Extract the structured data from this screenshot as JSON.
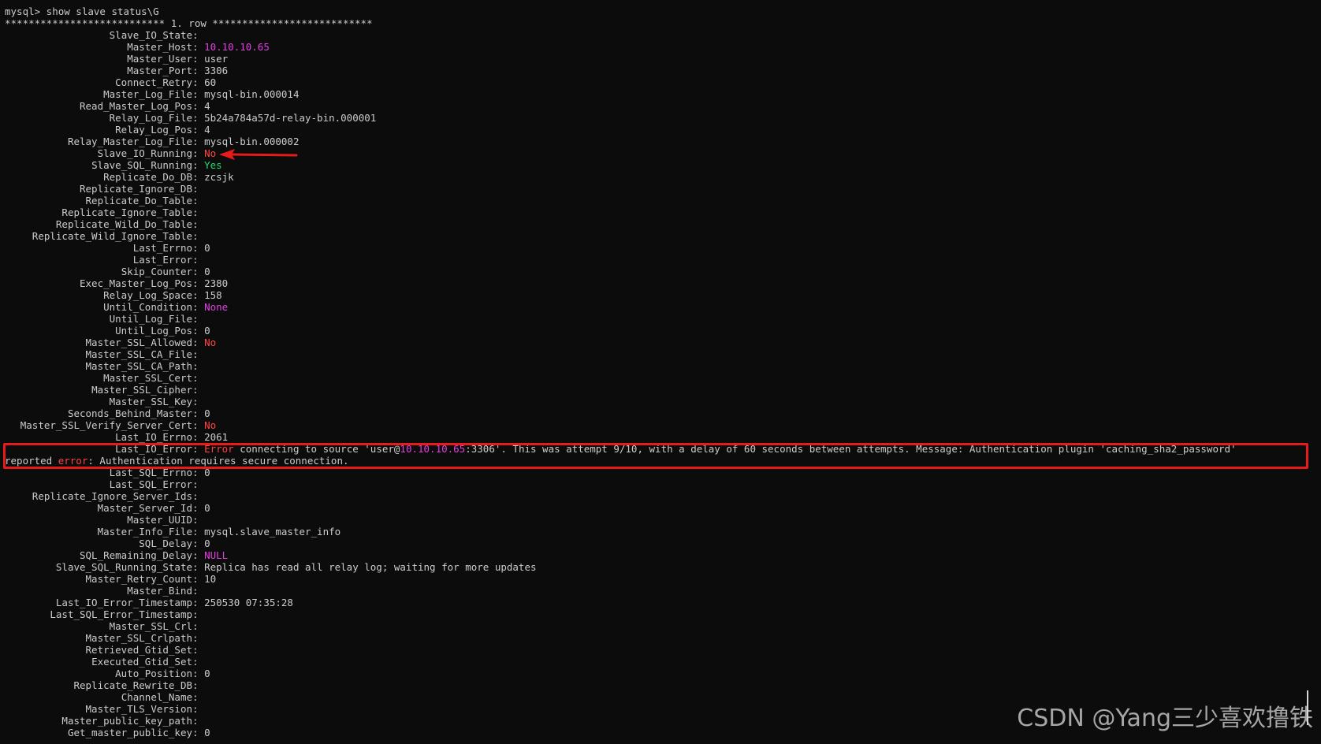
{
  "terminal": {
    "prompt": "mysql> show slave status\\G",
    "row_header": "*************************** 1. row ***************************",
    "fields": [
      {
        "label": "Slave_IO_State",
        "value": ""
      },
      {
        "label": "Master_Host",
        "value": "10.10.10.65",
        "color": "#e040e0"
      },
      {
        "label": "Master_User",
        "value": "user"
      },
      {
        "label": "Master_Port",
        "value": "3306"
      },
      {
        "label": "Connect_Retry",
        "value": "60"
      },
      {
        "label": "Master_Log_File",
        "value": "mysql-bin.000014"
      },
      {
        "label": "Read_Master_Log_Pos",
        "value": "4"
      },
      {
        "label": "Relay_Log_File",
        "value": "5b24a784a57d-relay-bin.000001"
      },
      {
        "label": "Relay_Log_Pos",
        "value": "4"
      },
      {
        "label": "Relay_Master_Log_File",
        "value": "mysql-bin.000002"
      },
      {
        "label": "Slave_IO_Running",
        "value": "No",
        "color": "#ff4444"
      },
      {
        "label": "Slave_SQL_Running",
        "value": "Yes",
        "color": "#22dd66"
      },
      {
        "label": "Replicate_Do_DB",
        "value": "zcsjk"
      },
      {
        "label": "Replicate_Ignore_DB",
        "value": ""
      },
      {
        "label": "Replicate_Do_Table",
        "value": ""
      },
      {
        "label": "Replicate_Ignore_Table",
        "value": ""
      },
      {
        "label": "Replicate_Wild_Do_Table",
        "value": ""
      },
      {
        "label": "Replicate_Wild_Ignore_Table",
        "value": ""
      },
      {
        "label": "Last_Errno",
        "value": "0"
      },
      {
        "label": "Last_Error",
        "value": ""
      },
      {
        "label": "Skip_Counter",
        "value": "0"
      },
      {
        "label": "Exec_Master_Log_Pos",
        "value": "2380"
      },
      {
        "label": "Relay_Log_Space",
        "value": "158"
      },
      {
        "label": "Until_Condition",
        "value": "None",
        "color": "#e040e0"
      },
      {
        "label": "Until_Log_File",
        "value": ""
      },
      {
        "label": "Until_Log_Pos",
        "value": "0"
      },
      {
        "label": "Master_SSL_Allowed",
        "value": "No",
        "color": "#ff4444"
      },
      {
        "label": "Master_SSL_CA_File",
        "value": ""
      },
      {
        "label": "Master_SSL_CA_Path",
        "value": ""
      },
      {
        "label": "Master_SSL_Cert",
        "value": ""
      },
      {
        "label": "Master_SSL_Cipher",
        "value": ""
      },
      {
        "label": "Master_SSL_Key",
        "value": ""
      },
      {
        "label": "Seconds_Behind_Master",
        "value": "0"
      },
      {
        "label": "Master_SSL_Verify_Server_Cert",
        "value": "No",
        "color": "#ff4444"
      },
      {
        "label": "Last_IO_Errno",
        "value": "2061"
      },
      {
        "label": "Last_IO_Error",
        "value": "",
        "error": true
      },
      {
        "label": "Last_SQL_Errno",
        "value": "0"
      },
      {
        "label": "Last_SQL_Error",
        "value": ""
      },
      {
        "label": "Replicate_Ignore_Server_Ids",
        "value": ""
      },
      {
        "label": "Master_Server_Id",
        "value": "0"
      },
      {
        "label": "Master_UUID",
        "value": ""
      },
      {
        "label": "Master_Info_File",
        "value": "mysql.slave_master_info"
      },
      {
        "label": "SQL_Delay",
        "value": "0"
      },
      {
        "label": "SQL_Remaining_Delay",
        "value": "NULL",
        "color": "#e040e0"
      },
      {
        "label": "Slave_SQL_Running_State",
        "value": "Replica has read all relay log; waiting for more updates"
      },
      {
        "label": "Master_Retry_Count",
        "value": "10"
      },
      {
        "label": "Master_Bind",
        "value": ""
      },
      {
        "label": "Last_IO_Error_Timestamp",
        "value": "250530 07:35:28"
      },
      {
        "label": "Last_SQL_Error_Timestamp",
        "value": ""
      },
      {
        "label": "Master_SSL_Crl",
        "value": ""
      },
      {
        "label": "Master_SSL_Crlpath",
        "value": ""
      },
      {
        "label": "Retrieved_Gtid_Set",
        "value": ""
      },
      {
        "label": "Executed_Gtid_Set",
        "value": ""
      },
      {
        "label": "Auto_Position",
        "value": "0"
      },
      {
        "label": "Replicate_Rewrite_DB",
        "value": ""
      },
      {
        "label": "Channel_Name",
        "value": ""
      },
      {
        "label": "Master_TLS_Version",
        "value": ""
      },
      {
        "label": "Master_public_key_path",
        "value": ""
      },
      {
        "label": "Get_master_public_key",
        "value": "0"
      }
    ],
    "io_error": {
      "line1": [
        {
          "text": "Error",
          "color": "#ff4444"
        },
        {
          "text": " connecting to source 'user@"
        },
        {
          "text": "10.10.10.65",
          "color": "#e040e0"
        },
        {
          "text": ":3306'. This was attempt 9/10, with a delay of 60 seconds between attempts. Message: Authentication plugin 'caching_sha2_password'"
        }
      ],
      "line2": [
        {
          "text": "reported "
        },
        {
          "text": "error",
          "color": "#ff4444"
        },
        {
          "text": ": Authentication requires secure connection."
        }
      ]
    }
  },
  "annotation": {
    "arrow_color": "#e81a1a",
    "box_color": "#e81a1a"
  },
  "watermark": {
    "text": "CSDN @Yang三少喜欢撸铁"
  }
}
